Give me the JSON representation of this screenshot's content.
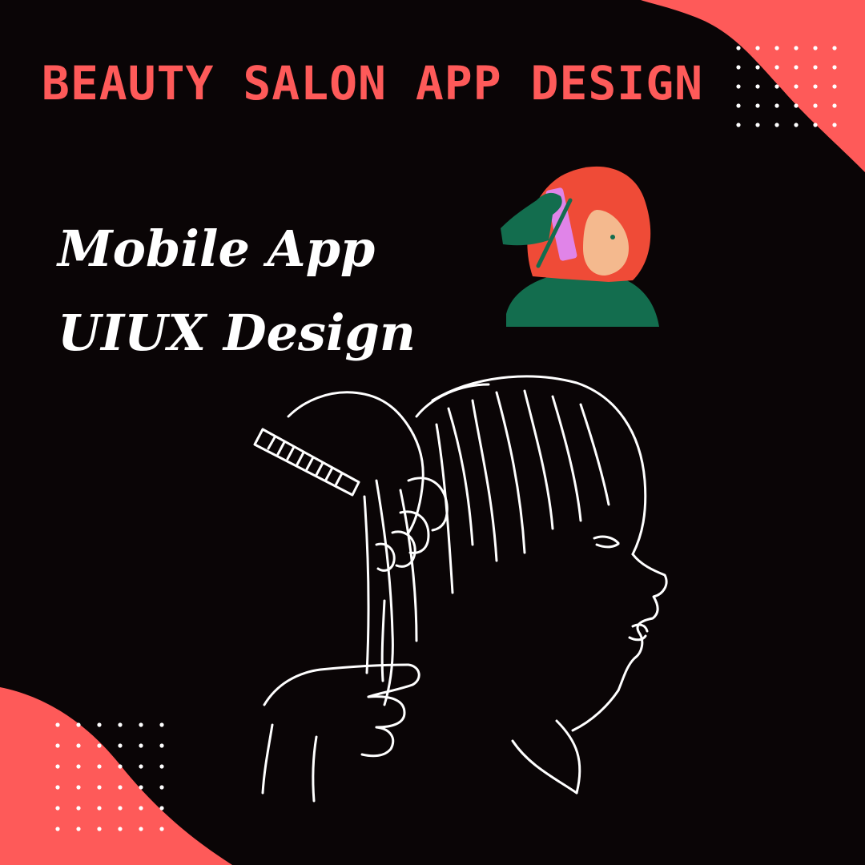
{
  "colors": {
    "background": "#0a0506",
    "accent": "#fe5a59",
    "text": "#ffffff",
    "illustration_green": "#136d4e",
    "illustration_hair": "#ef4b37",
    "illustration_skin": "#f4b98e",
    "illustration_pink": "#e084e8"
  },
  "header": {
    "title": "BEAUTY SALON APP DESIGN"
  },
  "main": {
    "subtitle_line1": "Mobile App",
    "subtitle_line2": "UIUX Design"
  },
  "icons": {
    "top_right_blob": "coral-wave-shape",
    "bottom_left_blob": "coral-wave-shape",
    "dot_grid": "dot-grid-pattern",
    "hair_dye_illustration": "woman-hair-dye-illustration",
    "haircut_line_art": "hairdresser-line-art"
  }
}
